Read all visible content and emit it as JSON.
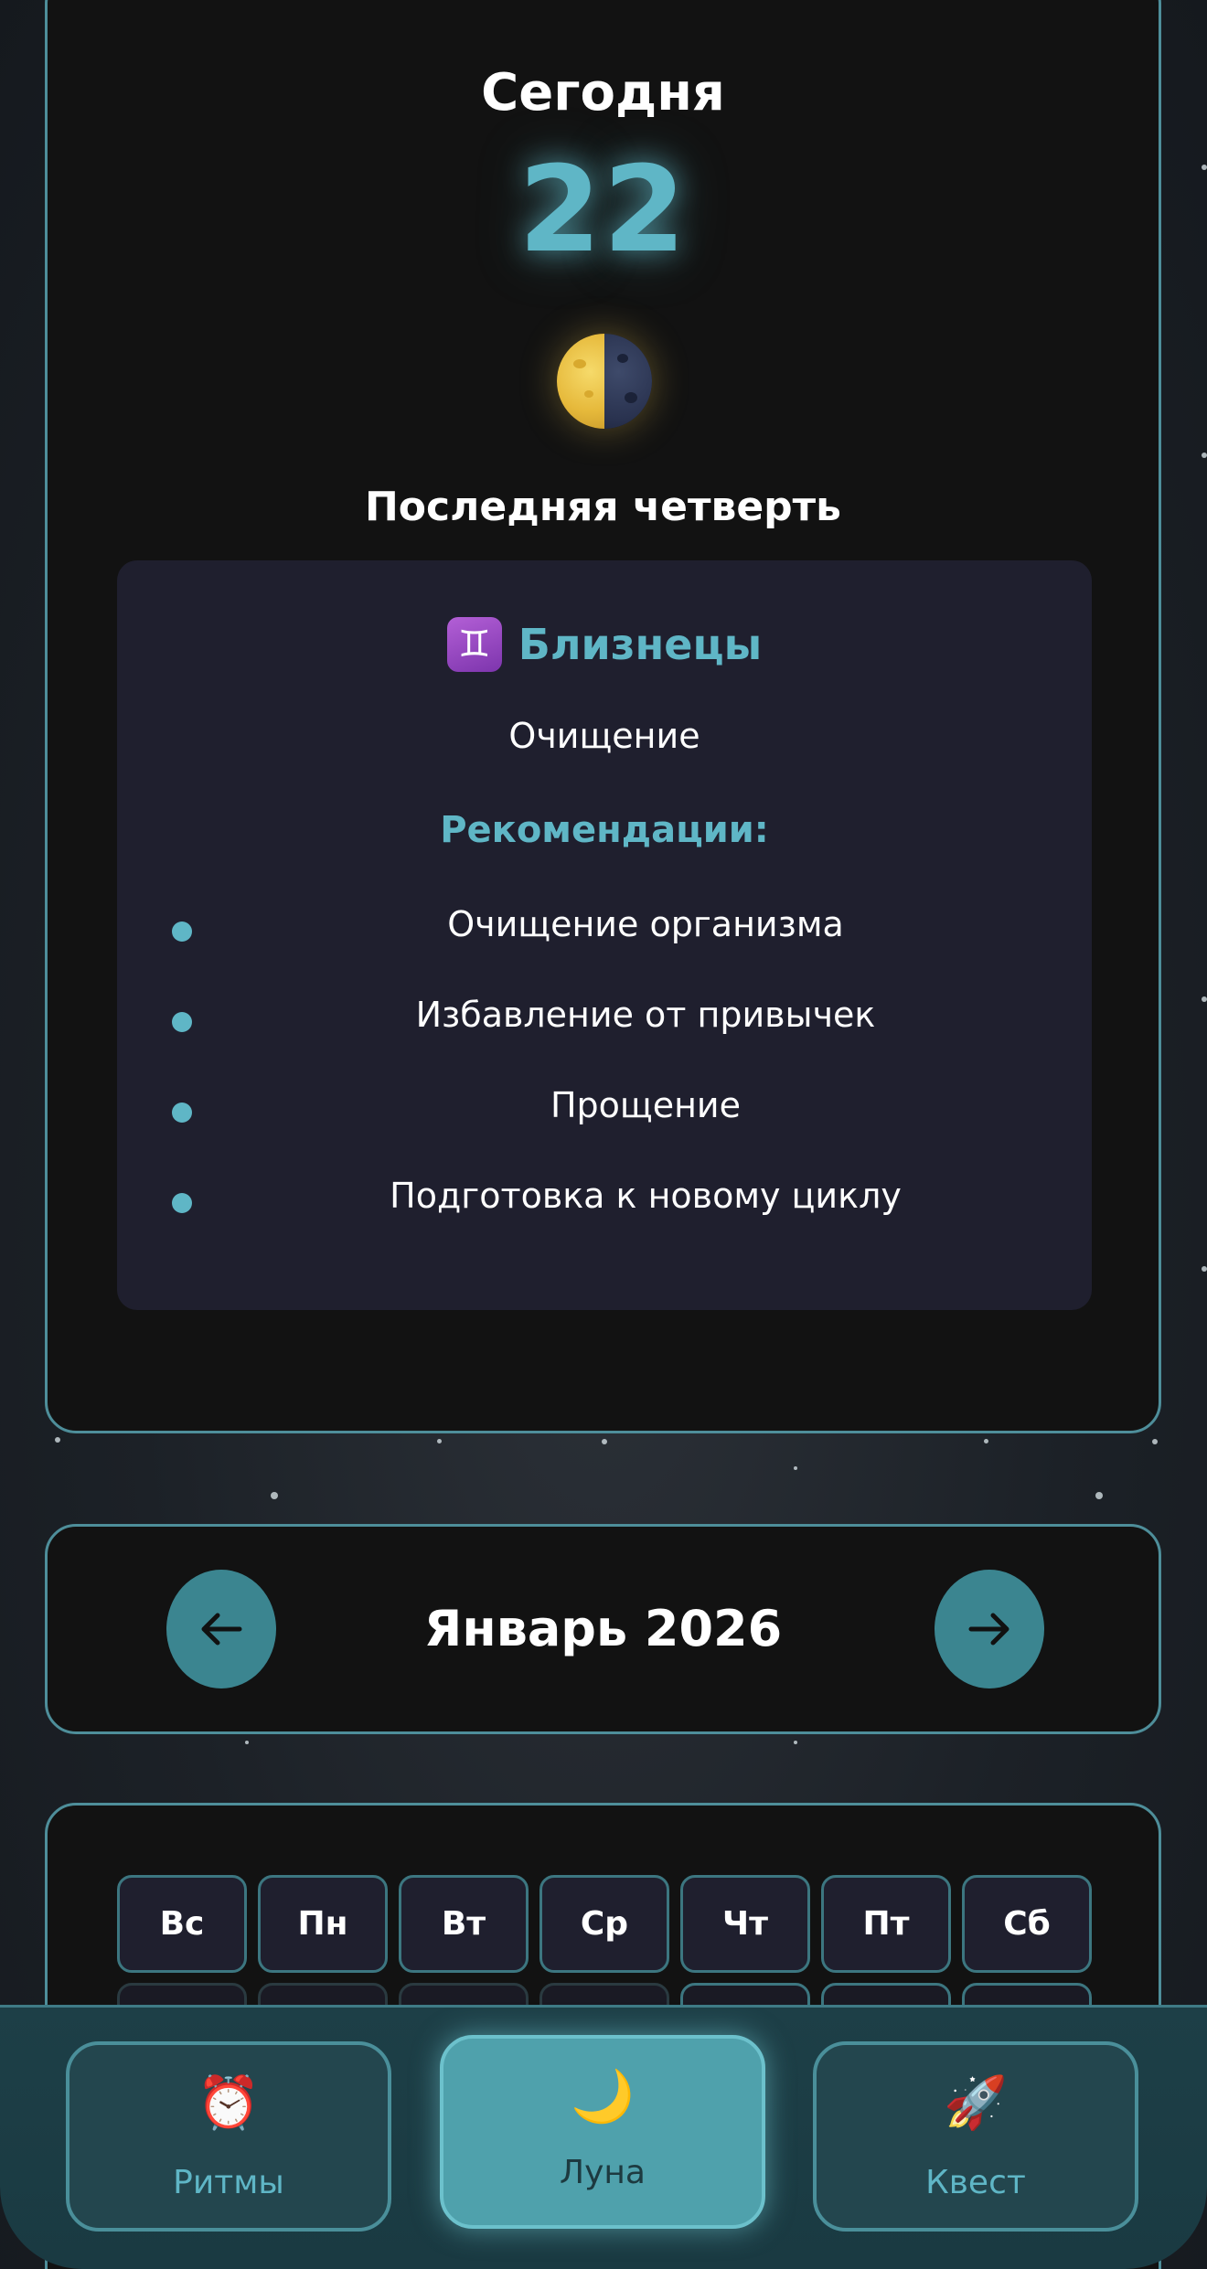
{
  "today": {
    "title": "Сегодня",
    "day_number": "22",
    "moon_icon": "last-quarter-moon-icon",
    "phase": "Последняя четверть"
  },
  "zodiac": {
    "icon": "gemini-icon",
    "symbol": "♊",
    "name": "Близнецы",
    "theme": "Очищение",
    "recommendations_title": "Рекомендации:",
    "recommendations": [
      "Очищение организма",
      "Избавление от привычек",
      "Прощение",
      "Подготовка к новому циклу"
    ]
  },
  "month_nav": {
    "title": "Январь 2026",
    "prev_icon": "arrow-left-icon",
    "next_icon": "arrow-right-icon"
  },
  "calendar": {
    "weekdays": [
      "Вс",
      "Пн",
      "Вт",
      "Ср",
      "Чт",
      "Пт",
      "Сб"
    ]
  },
  "tabs": [
    {
      "label": "Ритмы",
      "icon": "alarm-clock-icon",
      "glyph": "⏰",
      "active": false
    },
    {
      "label": "Луна",
      "icon": "crescent-moon-icon",
      "glyph": "🌙",
      "active": true
    },
    {
      "label": "Квест",
      "icon": "rocket-icon",
      "glyph": "🚀",
      "active": false
    }
  ],
  "colors": {
    "accent": "#5fb6c6",
    "card_border": "#4e8e9a",
    "card_bg": "#121212",
    "active_tab": "#4fa1ac"
  }
}
